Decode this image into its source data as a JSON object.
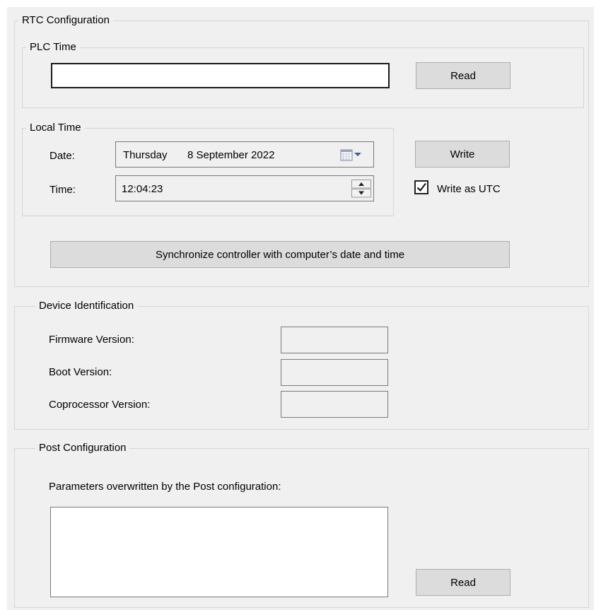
{
  "rtc": {
    "title": "RTC Configuration",
    "plc_time": {
      "title": "PLC Time",
      "value": "",
      "read_label": "Read"
    },
    "local_time": {
      "title": "Local Time",
      "date_label": "Date:",
      "date_day": "Thursday",
      "date_value": "8 September 2022",
      "time_label": "Time:",
      "time_value": "12:04:23"
    },
    "write_label": "Write",
    "write_as_utc_label": "Write as UTC",
    "write_as_utc_checked": true,
    "sync_label": "Synchronize controller with computer’s date and time"
  },
  "device": {
    "title": "Device Identification",
    "firmware_label": "Firmware Version:",
    "boot_label": "Boot Version:",
    "coprocessor_label": "Coprocessor Version:"
  },
  "post": {
    "title": "Post Configuration",
    "description": "Parameters overwritten by the Post configuration:",
    "read_label": "Read"
  },
  "icons": {
    "calendar": "calendar-dropdown-icon",
    "spinner": "up-down-spinner-icon",
    "check": "checkmark-icon"
  },
  "colors": {
    "panel_bg": "#f0f0f0",
    "button_bg": "#dcdcdc",
    "border": "#d5d5d5"
  }
}
